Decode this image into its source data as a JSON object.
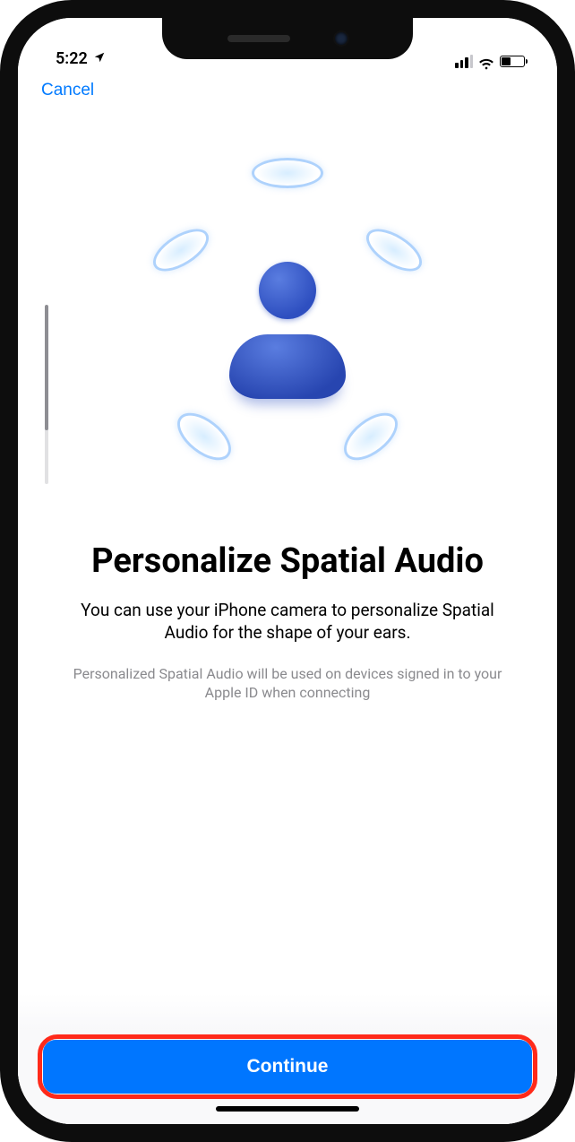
{
  "status": {
    "time": "5:22",
    "location_active": true,
    "battery_percent": 40
  },
  "nav": {
    "cancel_label": "Cancel"
  },
  "content": {
    "title": "Personalize Spatial Audio",
    "subtitle": "You can use your iPhone camera to personalize Spatial Audio for the shape of your ears.",
    "fineprint": "Personalized Spatial Audio will be used on devices signed in to your Apple ID when connecting"
  },
  "footer": {
    "continue_label": "Continue"
  },
  "colors": {
    "accent": "#007aff",
    "primary_button": "#0076ff",
    "highlight_ring": "#ff2a1a"
  }
}
